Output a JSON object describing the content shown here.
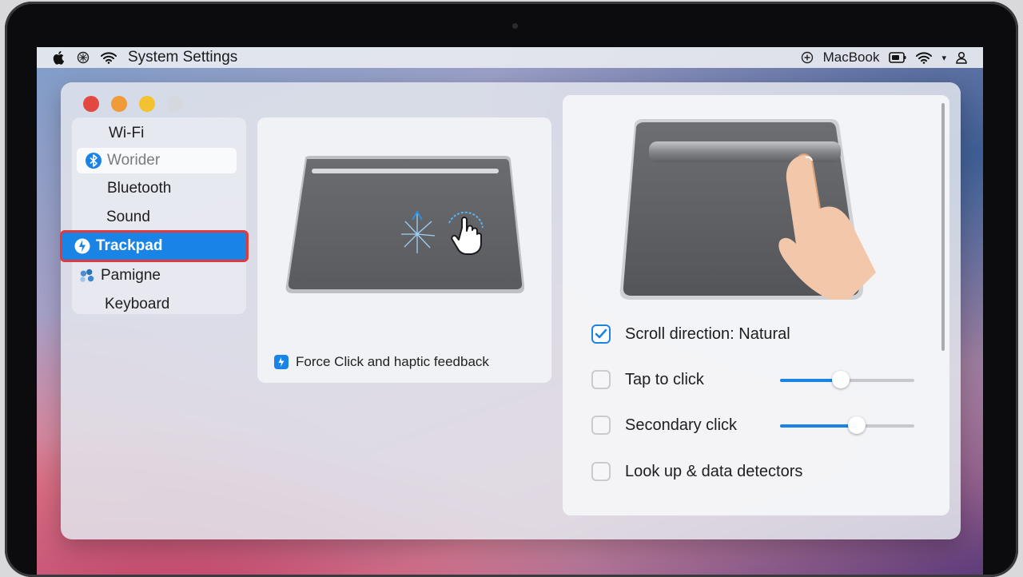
{
  "menubar": {
    "app_title": "System Settings",
    "device_name": "MacBook",
    "icons": [
      "apple-icon",
      "siri-icon",
      "wifi-icon",
      "control-center-icon",
      "battery-icon",
      "wifi-icon",
      "user-icon"
    ]
  },
  "sidebar": {
    "items": [
      {
        "label": "Wi-Fi",
        "icon": ""
      },
      {
        "label": "Worider",
        "icon": "bluetooth-icon"
      },
      {
        "label": "Bluetooth",
        "icon": ""
      },
      {
        "label": "Sound",
        "icon": ""
      },
      {
        "label": "Trackpad",
        "icon": "trackpad-icon"
      },
      {
        "label": "Pamigne",
        "icon": "people-icon"
      },
      {
        "label": "Keyboard",
        "icon": ""
      }
    ],
    "selected": "Trackpad"
  },
  "middle": {
    "caption": "Force Click and haptic feedback"
  },
  "right": {
    "options": [
      {
        "label": "Scroll direction: Natural",
        "checked": true
      },
      {
        "label": "Tap to click",
        "checked": false,
        "slider": 0.45
      },
      {
        "label": "Secondary click",
        "checked": false,
        "slider": 0.57
      },
      {
        "label": "Look up & data detectors",
        "checked": false
      }
    ]
  },
  "colors": {
    "accent": "#1a84e6",
    "selection_outline": "#e23a3a"
  }
}
